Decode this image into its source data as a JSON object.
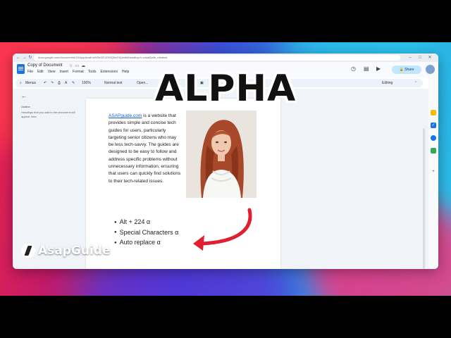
{
  "browser": {
    "url": "docs.google.com/document/d/1KApqdecaKmW0hOE1Z0GQhbGiQ/edit#heading=h.vdsat2pdb_rdeatwd"
  },
  "doc": {
    "title": "Copy of Document",
    "menu": [
      "File",
      "Edit",
      "View",
      "Insert",
      "Format",
      "Tools",
      "Extensions",
      "Help"
    ],
    "share_label": "Share"
  },
  "toolbar": {
    "search": "Menus",
    "zoom": "100%",
    "style": "Normal text",
    "font": "Open...",
    "mode": "Editing"
  },
  "outline": {
    "title": "Outline",
    "hint": "Headings that you add to the document will appear here."
  },
  "content": {
    "link_text": "ASAPguide.com",
    "paragraph": " is a website that provides simple and concise tech guides for users, particularly targeting senior citizens who may be less tech-savvy. The guides are designed to  be easy to follow and address specific problems without  unnecessary information, ensuring that users can quickly find solutions to their tech-related issues.",
    "bullets": [
      "Alt + 224 α",
      "Special Characters α",
      "Auto replace α"
    ]
  },
  "overlay": {
    "title": "ALPHA",
    "brand": "AsapGuide"
  },
  "colors": {
    "accent": "#1a73e8",
    "share_bg": "#c2e7ff",
    "arrow": "#e02030"
  }
}
